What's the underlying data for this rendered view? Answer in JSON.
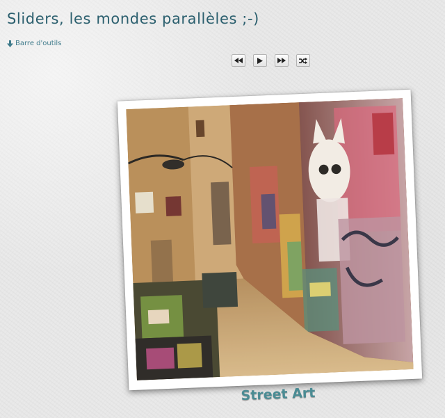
{
  "page": {
    "title": "Sliders, les mondes parallèles ;-)"
  },
  "toolbar_link": {
    "label": "Barre d'outils",
    "icon": "arrow-down-icon"
  },
  "controls": [
    {
      "name": "previous",
      "icon": "rewind-icon"
    },
    {
      "name": "play",
      "icon": "play-icon"
    },
    {
      "name": "next",
      "icon": "fast-forward-icon"
    },
    {
      "name": "shuffle",
      "icon": "shuffle-icon"
    }
  ],
  "slide": {
    "caption": "Street Art",
    "image_subject": "graffiti alley"
  },
  "colors": {
    "title": "#2b5f6e",
    "link": "#3f7b8b",
    "caption": "#4b8c94",
    "background": "#e9e9e9"
  }
}
